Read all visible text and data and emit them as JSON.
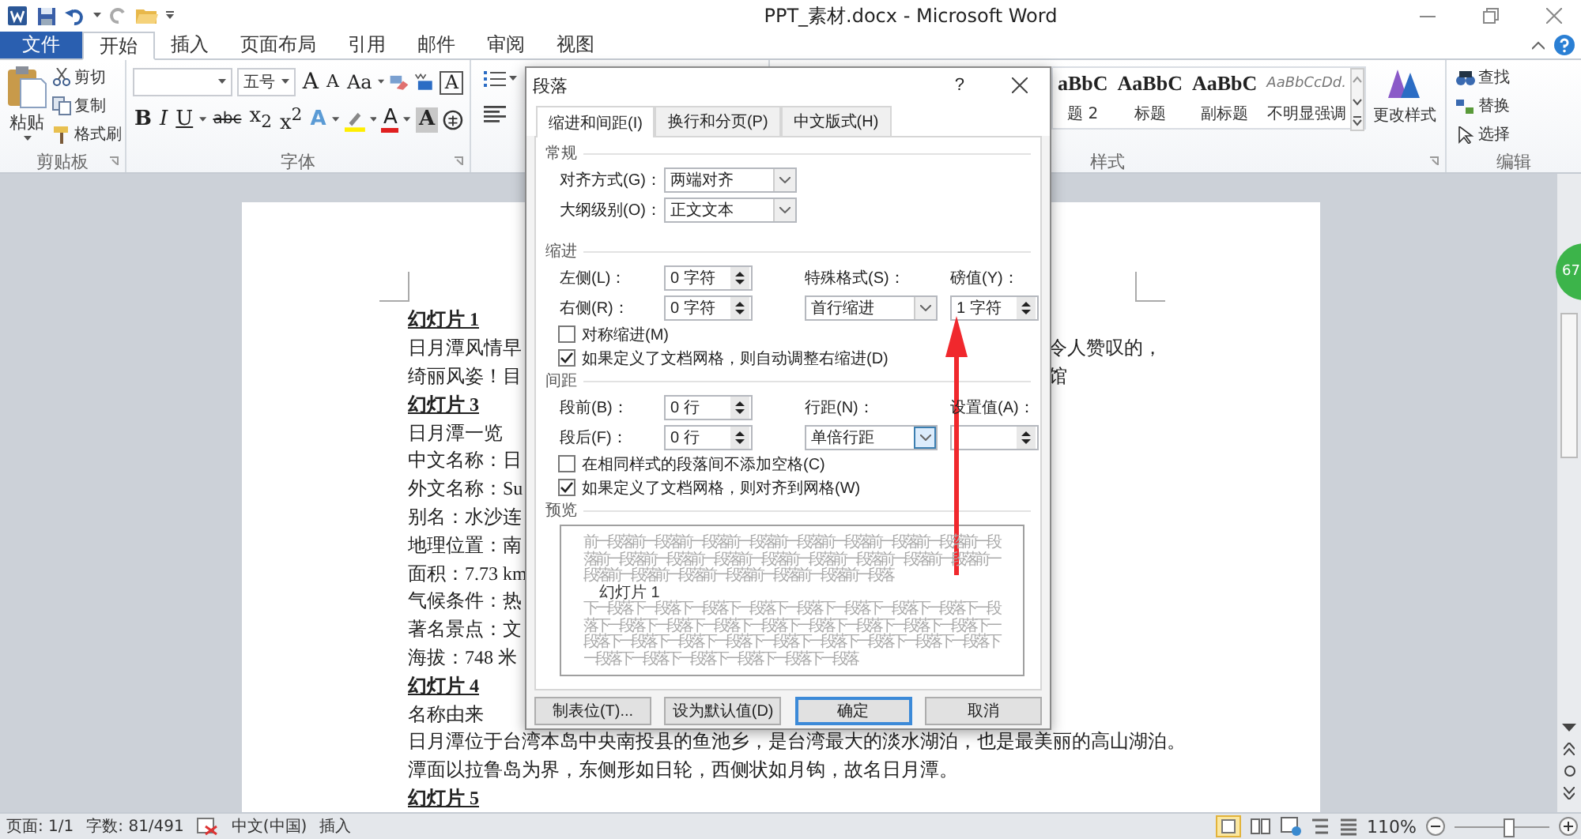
{
  "window": {
    "title": "PPT_素材.docx - Microsoft Word"
  },
  "tabs": [
    {
      "label": "文件",
      "kind": "file",
      "selected": false
    },
    {
      "label": "开始",
      "kind": "tab",
      "selected": true
    },
    {
      "label": "插入",
      "kind": "tab",
      "selected": false
    },
    {
      "label": "页面布局",
      "kind": "tab",
      "selected": false
    },
    {
      "label": "引用",
      "kind": "tab",
      "selected": false
    },
    {
      "label": "邮件",
      "kind": "tab",
      "selected": false
    },
    {
      "label": "审阅",
      "kind": "tab",
      "selected": false
    },
    {
      "label": "视图",
      "kind": "tab",
      "selected": false
    }
  ],
  "clipboard": {
    "paste": "粘贴",
    "label": "剪贴板",
    "items": [
      {
        "label": "剪切",
        "kind": "cut"
      },
      {
        "label": "复制",
        "kind": "copy"
      },
      {
        "label": "格式刷",
        "kind": "painter"
      }
    ]
  },
  "font": {
    "size": "五号",
    "label": "字体",
    "row1": [
      {
        "kind": "grow",
        "text": "A"
      },
      {
        "kind": "shrink",
        "text": "A"
      },
      {
        "kind": "case",
        "text": "Aa"
      },
      {
        "kind": "clear"
      },
      {
        "kind": "phonetic"
      },
      {
        "kind": "border",
        "text": "A"
      }
    ],
    "row2": [
      {
        "kind": "bold",
        "text": "B"
      },
      {
        "kind": "italic",
        "text": "I"
      },
      {
        "kind": "underline",
        "text": "U"
      },
      {
        "kind": "strike",
        "text": "abc"
      },
      {
        "kind": "sub",
        "text": "x$_{2}$"
      },
      {
        "kind": "sup",
        "text": "x$^{2}$"
      },
      {
        "kind": "effects",
        "text": "A"
      },
      {
        "kind": "highlight"
      },
      {
        "kind": "color",
        "text": "A"
      },
      {
        "kind": "shading",
        "text": "A"
      },
      {
        "kind": "enclose"
      }
    ]
  },
  "styles": {
    "label": "样式",
    "change": "更改样式",
    "items": [
      {
        "sample": "aBbC",
        "name": "题 2",
        "kind": "heading"
      },
      {
        "sample": "AaBbC",
        "name": "标题",
        "kind": "heading"
      },
      {
        "sample": "AaBbC",
        "name": "副标题",
        "kind": "heading"
      },
      {
        "sample": "AaBbCcDd.",
        "name": "不明显强调",
        "kind": "emphasis"
      }
    ]
  },
  "editing": {
    "label": "编辑",
    "items": [
      {
        "label": "查找",
        "kind": "find"
      },
      {
        "label": "替换",
        "kind": "replace"
      },
      {
        "label": "选择",
        "kind": "select"
      }
    ]
  },
  "document": {
    "lines": [
      {
        "text": "幻灯片 1",
        "kind": "heading"
      },
      {
        "text": "日月潭风情早",
        "right": "令人赞叹的，",
        "kind": "body"
      },
      {
        "text": "绮丽风姿！目",
        "right": "馆",
        "kind": "body"
      },
      {
        "text": "幻灯片 3",
        "kind": "heading"
      },
      {
        "text": "日月潭一览",
        "kind": "body"
      },
      {
        "text": "中文名称：日",
        "kind": "body"
      },
      {
        "text": "外文名称：Su",
        "kind": "body"
      },
      {
        "text": "别名：水沙连",
        "kind": "body"
      },
      {
        "text": "地理位置：南",
        "kind": "body"
      },
      {
        "text": "面积：7.73 km",
        "kind": "body"
      },
      {
        "text": "气候条件：热",
        "kind": "body"
      },
      {
        "text": "著名景点：文",
        "kind": "body"
      },
      {
        "text": "海拔：748 米",
        "kind": "body"
      },
      {
        "text": "幻灯片 4",
        "kind": "heading"
      },
      {
        "text": "名称由来",
        "kind": "body"
      },
      {
        "text": "日月潭位于台湾本岛中央南投县的鱼池乡，是台湾最大的淡水湖泊，也是最美丽的高山湖泊。",
        "kind": "body"
      },
      {
        "text": "潭面以拉鲁岛为界，东侧形如日轮，西侧状如月钩，故名日月潭。",
        "kind": "body"
      },
      {
        "text": "幻灯片 5",
        "kind": "heading"
      }
    ]
  },
  "dialog": {
    "title": "段落",
    "help": "?",
    "tabs": [
      {
        "label": "缩进和间距(I)",
        "selected": true
      },
      {
        "label": "换行和分页(P)",
        "selected": false
      },
      {
        "label": "中文版式(H)",
        "selected": false
      }
    ],
    "general": {
      "heading": "常规",
      "alignment": {
        "label": "对齐方式(G)：",
        "value": "两端对齐"
      },
      "outline": {
        "label": "大纲级别(O)：",
        "value": "正文文本"
      }
    },
    "indent": {
      "heading": "缩进",
      "left": {
        "label": "左侧(L)：",
        "value": "0 字符"
      },
      "right": {
        "label": "右侧(R)：",
        "value": "0 字符"
      },
      "special": {
        "label": "特殊格式(S)：",
        "value": "首行缩进"
      },
      "by": {
        "label": "磅值(Y)：",
        "value": "1 字符"
      },
      "checks": [
        {
          "label": "对称缩进(M)",
          "checked": false
        },
        {
          "label": "如果定义了文档网格，则自动调整右缩进(D)",
          "checked": true
        }
      ]
    },
    "spacing": {
      "heading": "间距",
      "before": {
        "label": "段前(B)：",
        "value": "0 行"
      },
      "after": {
        "label": "段后(F)：",
        "value": "0 行"
      },
      "line": {
        "label": "行距(N)：",
        "value": "单倍行距",
        "focused": true
      },
      "at": {
        "label": "设置值(A)："
      },
      "checks": [
        {
          "label": "在相同样式的段落间不添加空格(C)",
          "checked": false
        },
        {
          "label": "如果定义了文档网格，则对齐到网格(W)",
          "checked": true
        }
      ]
    },
    "preview": {
      "heading": "预览",
      "before": "前一段落前一段落前一段落前一段落前一段落前一段落前一段落前一段落前一段落前一段落前一段落前一段落前一段落前一段落前一段落前一段落前一段落前一段落前一段落前一段落前一段落前一段落前一段落前一段落",
      "sample": "幻灯片 1",
      "after": "下一段落下一段落下一段落下一段落下一段落下一段落下一段落下一段落下一段落下一段落下一段落下一段落下一段落下一段落下一段落下一段落下一段落下一段落下一段落下一段落下一段落下一段落下一段落下一段落下一段落下一段落下一段落下一段落下一段落下一段落下一段落下一段落"
    },
    "buttons": [
      {
        "label": "制表位(T)...",
        "default": false
      },
      {
        "label": "设为默认值(D)",
        "default": false
      },
      {
        "label": "确定",
        "default": true
      },
      {
        "label": "取消",
        "default": false
      }
    ]
  },
  "side_badge": "67",
  "status_bar": {
    "page": "页面: 1/1",
    "words": "字数: 81/491",
    "language": "中文(中国)",
    "mode": "插入",
    "zoom": "110%",
    "zoom_slider": {
      "level": 0.55
    }
  }
}
